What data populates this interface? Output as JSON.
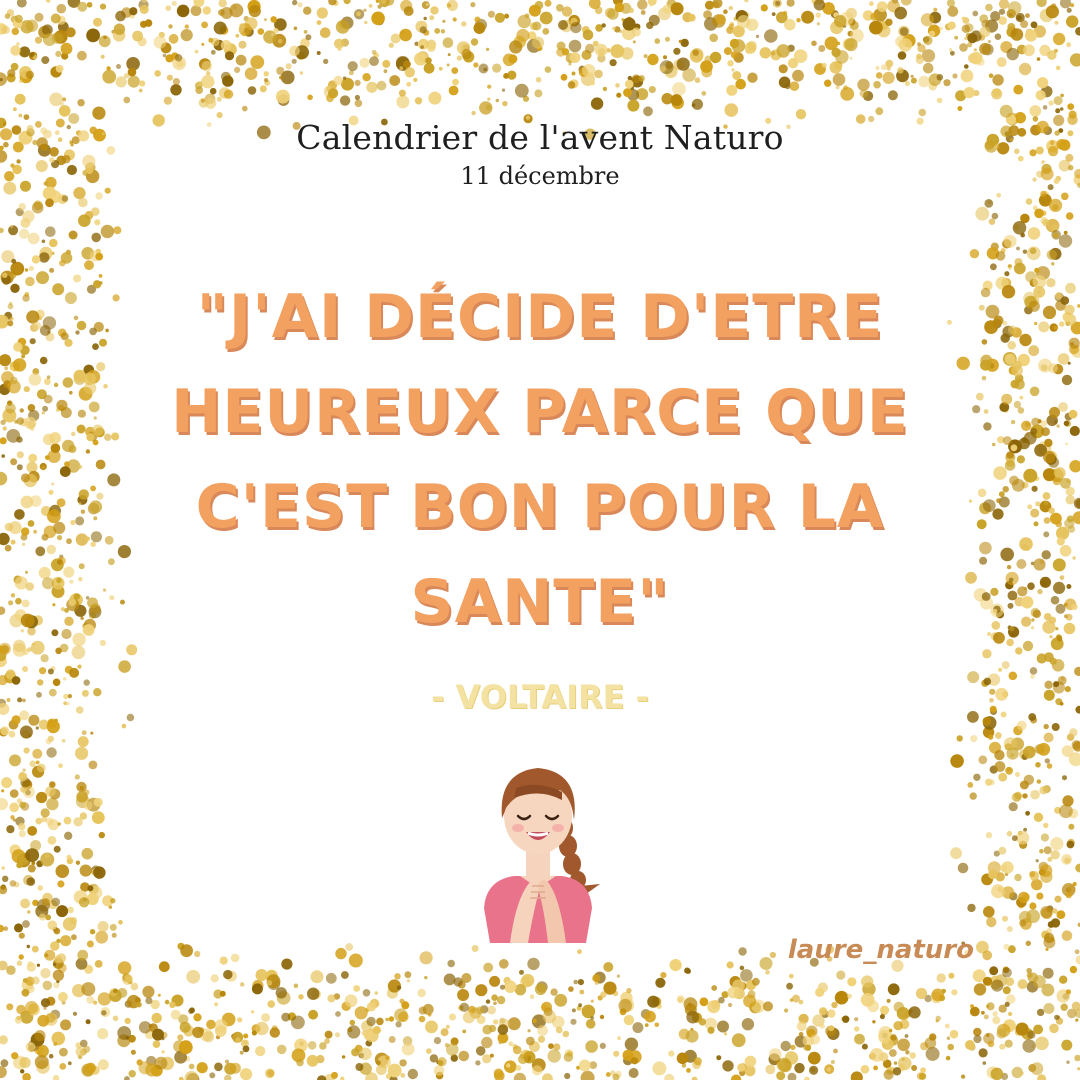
{
  "header": {
    "title": "Calendrier de l'avent Naturo",
    "date": "11 décembre"
  },
  "quote": {
    "lines": [
      "\"J'AI DÉCIDE D'ETRE",
      "HEUREUX PARCE QUE",
      "C'EST BON POUR LA",
      "SANTE\""
    ],
    "author": "- VOLTAIRE -"
  },
  "footer": {
    "handle": "laure_naturo"
  },
  "colors": {
    "quote": "#f2a160",
    "author": "#f3e2a2",
    "handle": "#c98b55",
    "glitter": [
      "#b8860b",
      "#d4a017",
      "#e6c35c",
      "#8b6508",
      "#f0d27a",
      "#c9a227"
    ]
  },
  "illustration": "smiling-woman-hands-clasped"
}
